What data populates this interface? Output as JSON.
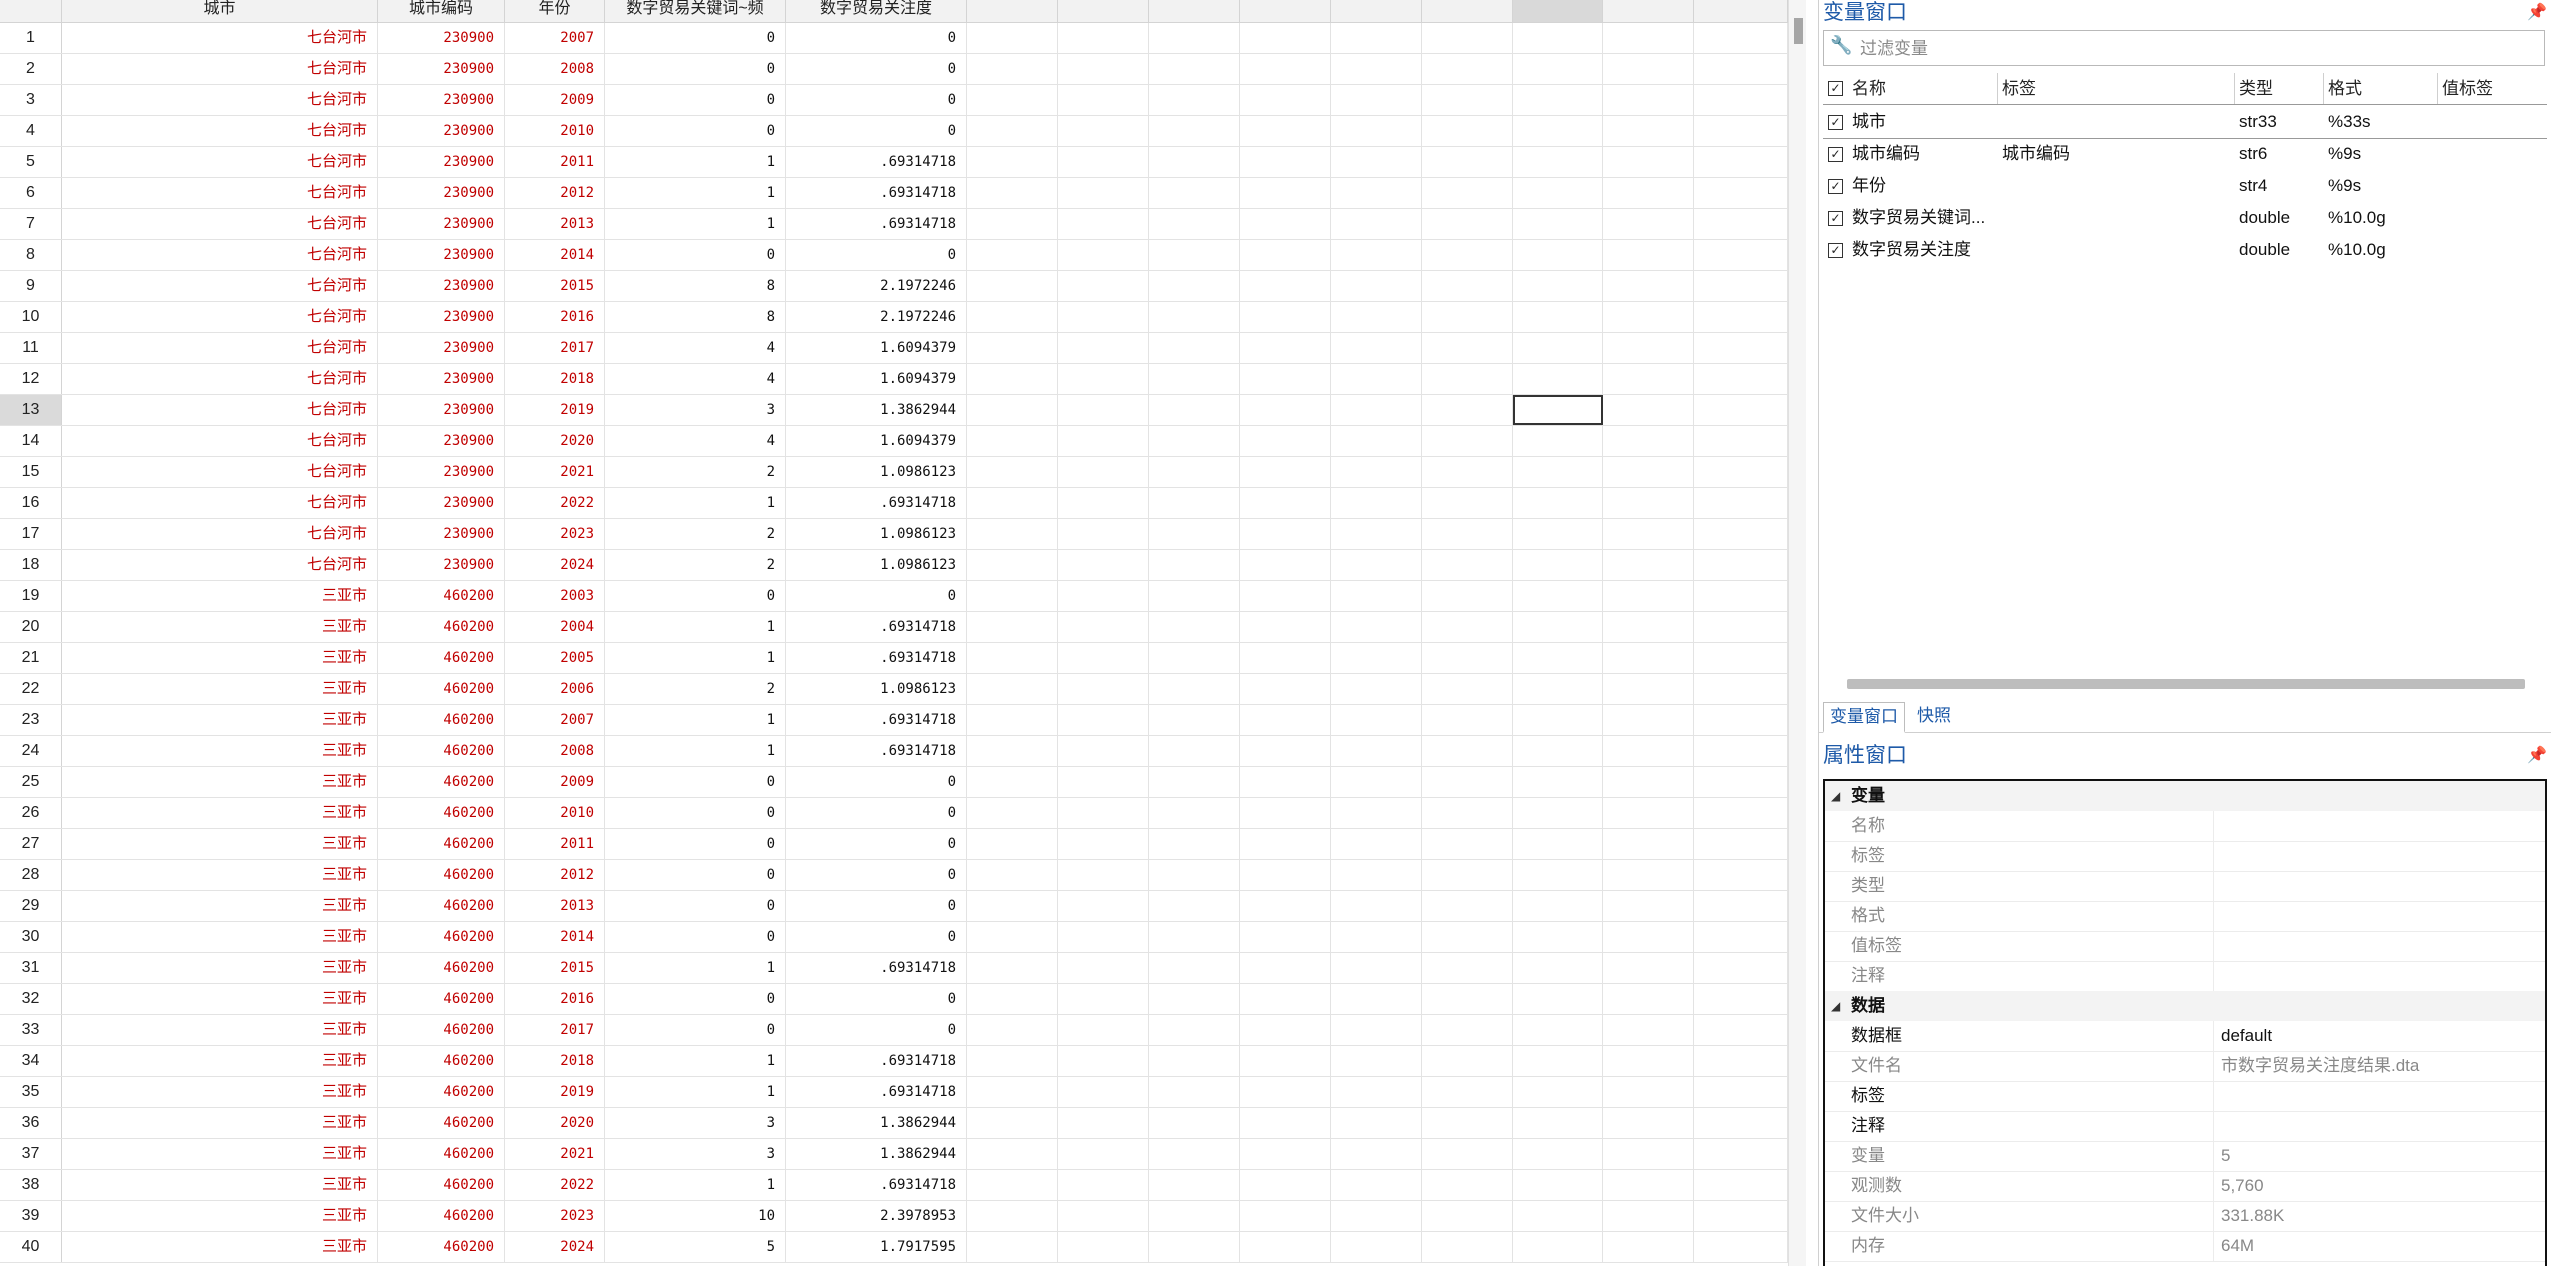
{
  "grid": {
    "columns": [
      "城市",
      "城市编码",
      "年份",
      "数字贸易关键词~频",
      "数字贸易关注度"
    ],
    "rows": [
      {
        "n": "1",
        "city": "七台河市",
        "code": "230900",
        "year": "2007",
        "freq": "0",
        "attn": "0"
      },
      {
        "n": "2",
        "city": "七台河市",
        "code": "230900",
        "year": "2008",
        "freq": "0",
        "attn": "0"
      },
      {
        "n": "3",
        "city": "七台河市",
        "code": "230900",
        "year": "2009",
        "freq": "0",
        "attn": "0"
      },
      {
        "n": "4",
        "city": "七台河市",
        "code": "230900",
        "year": "2010",
        "freq": "0",
        "attn": "0"
      },
      {
        "n": "5",
        "city": "七台河市",
        "code": "230900",
        "year": "2011",
        "freq": "1",
        "attn": ".69314718"
      },
      {
        "n": "6",
        "city": "七台河市",
        "code": "230900",
        "year": "2012",
        "freq": "1",
        "attn": ".69314718"
      },
      {
        "n": "7",
        "city": "七台河市",
        "code": "230900",
        "year": "2013",
        "freq": "1",
        "attn": ".69314718"
      },
      {
        "n": "8",
        "city": "七台河市",
        "code": "230900",
        "year": "2014",
        "freq": "0",
        "attn": "0"
      },
      {
        "n": "9",
        "city": "七台河市",
        "code": "230900",
        "year": "2015",
        "freq": "8",
        "attn": "2.1972246"
      },
      {
        "n": "10",
        "city": "七台河市",
        "code": "230900",
        "year": "2016",
        "freq": "8",
        "attn": "2.1972246"
      },
      {
        "n": "11",
        "city": "七台河市",
        "code": "230900",
        "year": "2017",
        "freq": "4",
        "attn": "1.6094379"
      },
      {
        "n": "12",
        "city": "七台河市",
        "code": "230900",
        "year": "2018",
        "freq": "4",
        "attn": "1.6094379"
      },
      {
        "n": "13",
        "city": "七台河市",
        "code": "230900",
        "year": "2019",
        "freq": "3",
        "attn": "1.3862944"
      },
      {
        "n": "14",
        "city": "七台河市",
        "code": "230900",
        "year": "2020",
        "freq": "4",
        "attn": "1.6094379"
      },
      {
        "n": "15",
        "city": "七台河市",
        "code": "230900",
        "year": "2021",
        "freq": "2",
        "attn": "1.0986123"
      },
      {
        "n": "16",
        "city": "七台河市",
        "code": "230900",
        "year": "2022",
        "freq": "1",
        "attn": ".69314718"
      },
      {
        "n": "17",
        "city": "七台河市",
        "code": "230900",
        "year": "2023",
        "freq": "2",
        "attn": "1.0986123"
      },
      {
        "n": "18",
        "city": "七台河市",
        "code": "230900",
        "year": "2024",
        "freq": "2",
        "attn": "1.0986123"
      },
      {
        "n": "19",
        "city": "三亚市",
        "code": "460200",
        "year": "2003",
        "freq": "0",
        "attn": "0"
      },
      {
        "n": "20",
        "city": "三亚市",
        "code": "460200",
        "year": "2004",
        "freq": "1",
        "attn": ".69314718"
      },
      {
        "n": "21",
        "city": "三亚市",
        "code": "460200",
        "year": "2005",
        "freq": "1",
        "attn": ".69314718"
      },
      {
        "n": "22",
        "city": "三亚市",
        "code": "460200",
        "year": "2006",
        "freq": "2",
        "attn": "1.0986123"
      },
      {
        "n": "23",
        "city": "三亚市",
        "code": "460200",
        "year": "2007",
        "freq": "1",
        "attn": ".69314718"
      },
      {
        "n": "24",
        "city": "三亚市",
        "code": "460200",
        "year": "2008",
        "freq": "1",
        "attn": ".69314718"
      },
      {
        "n": "25",
        "city": "三亚市",
        "code": "460200",
        "year": "2009",
        "freq": "0",
        "attn": "0"
      },
      {
        "n": "26",
        "city": "三亚市",
        "code": "460200",
        "year": "2010",
        "freq": "0",
        "attn": "0"
      },
      {
        "n": "27",
        "city": "三亚市",
        "code": "460200",
        "year": "2011",
        "freq": "0",
        "attn": "0"
      },
      {
        "n": "28",
        "city": "三亚市",
        "code": "460200",
        "year": "2012",
        "freq": "0",
        "attn": "0"
      },
      {
        "n": "29",
        "city": "三亚市",
        "code": "460200",
        "year": "2013",
        "freq": "0",
        "attn": "0"
      },
      {
        "n": "30",
        "city": "三亚市",
        "code": "460200",
        "year": "2014",
        "freq": "0",
        "attn": "0"
      },
      {
        "n": "31",
        "city": "三亚市",
        "code": "460200",
        "year": "2015",
        "freq": "1",
        "attn": ".69314718"
      },
      {
        "n": "32",
        "city": "三亚市",
        "code": "460200",
        "year": "2016",
        "freq": "0",
        "attn": "0"
      },
      {
        "n": "33",
        "city": "三亚市",
        "code": "460200",
        "year": "2017",
        "freq": "0",
        "attn": "0"
      },
      {
        "n": "34",
        "city": "三亚市",
        "code": "460200",
        "year": "2018",
        "freq": "1",
        "attn": ".69314718"
      },
      {
        "n": "35",
        "city": "三亚市",
        "code": "460200",
        "year": "2019",
        "freq": "1",
        "attn": ".69314718"
      },
      {
        "n": "36",
        "city": "三亚市",
        "code": "460200",
        "year": "2020",
        "freq": "3",
        "attn": "1.3862944"
      },
      {
        "n": "37",
        "city": "三亚市",
        "code": "460200",
        "year": "2021",
        "freq": "3",
        "attn": "1.3862944"
      },
      {
        "n": "38",
        "city": "三亚市",
        "code": "460200",
        "year": "2022",
        "freq": "1",
        "attn": ".69314718"
      },
      {
        "n": "39",
        "city": "三亚市",
        "code": "460200",
        "year": "2023",
        "freq": "10",
        "attn": "2.3978953"
      },
      {
        "n": "40",
        "city": "三亚市",
        "code": "460200",
        "year": "2024",
        "freq": "5",
        "attn": "1.7917595"
      }
    ],
    "selected_row": "13"
  },
  "variables": {
    "title": "变量窗口",
    "filter_placeholder": "过滤变量",
    "headers": {
      "name": "名称",
      "label": "标签",
      "type": "类型",
      "format": "格式",
      "value_label": "值标签"
    },
    "items": [
      {
        "name": "城市",
        "label": "",
        "type": "str33",
        "format": "%33s"
      },
      {
        "name": "城市编码",
        "label": "城市编码",
        "type": "str6",
        "format": "%9s"
      },
      {
        "name": "年份",
        "label": "",
        "type": "str4",
        "format": "%9s"
      },
      {
        "name": "数字贸易关键词...",
        "label": "",
        "type": "double",
        "format": "%10.0g"
      },
      {
        "name": "数字贸易关注度",
        "label": "",
        "type": "double",
        "format": "%10.0g"
      }
    ],
    "tabs": [
      "变量窗口",
      "快照"
    ]
  },
  "properties": {
    "title": "属性窗口",
    "sections": {
      "variable": {
        "label": "变量",
        "rows": [
          {
            "key": "名称",
            "value": ""
          },
          {
            "key": "标签",
            "value": ""
          },
          {
            "key": "类型",
            "value": ""
          },
          {
            "key": "格式",
            "value": ""
          },
          {
            "key": "值标签",
            "value": ""
          },
          {
            "key": "注释",
            "value": ""
          }
        ]
      },
      "data": {
        "label": "数据",
        "rows": [
          {
            "key": "数据框",
            "value": "default"
          },
          {
            "key": "文件名",
            "value": "市数字贸易关注度结果.dta"
          },
          {
            "key": "标签",
            "value": ""
          },
          {
            "key": "注释",
            "value": ""
          },
          {
            "key": "变量",
            "value": "5"
          },
          {
            "key": "观测数",
            "value": "5,760"
          },
          {
            "key": "文件大小",
            "value": "331.88K"
          },
          {
            "key": "内存",
            "value": "64M"
          }
        ]
      }
    }
  }
}
